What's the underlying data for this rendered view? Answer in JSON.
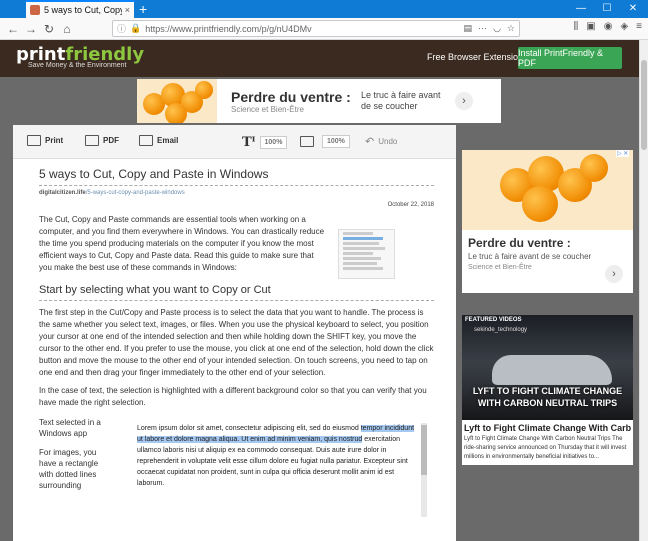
{
  "browser": {
    "tab_title": "5 ways to Cut, Copy and Paste",
    "tab_close": "×",
    "new_tab": "+",
    "url": "https://www.printfriendly.com/p/g/nU4DMv",
    "window_controls": [
      "—",
      "☐",
      "✕"
    ]
  },
  "pf_header": {
    "logo_print": "print",
    "logo_friendly": "friendly",
    "tagline": "Save Money & the Environment",
    "extension_label": "Free  Browser Extension!",
    "install_button": "Install PrintFriendly & PDF"
  },
  "top_ad": {
    "title": "Perdre du ventre :",
    "source": "Science et Bien-Être",
    "description": "Le truc à faire avant de se coucher",
    "arrow": "›"
  },
  "toolbar": {
    "print_label": "Print",
    "pdf_label": "PDF",
    "email_label": "Email",
    "text_size": "100%",
    "image_size": "100%",
    "undo_label": "Undo"
  },
  "article": {
    "title": "5 ways to Cut, Copy and Paste in Windows",
    "site_domain": "digitalcitizen.life",
    "site_path": "/5-ways-cut-copy-and-paste-windows",
    "date": "October 22, 2018",
    "intro": "The Cut, Copy and Paste commands are essential tools when working on a computer, and you find them everywhere in Windows. You can drastically reduce the time you spend producing materials on the computer if you know the most efficient ways to Cut, Copy and Paste data. Read this guide to make sure that you make the best use of these commands in Windows:",
    "heading": "Start by selecting what you want to Copy or Cut",
    "para1": "The first step in the Cut/Copy and Paste process is to select the data that you want to handle. The process is the same whether you select text, images, or files. When you use the physical keyboard to select, you position your cursor at one end of the intended selection and then while holding down the SHIFT key, you move the cursor to the other end. If you prefer to use the mouse, you click at one end of the selection, hold down the click button and move the mouse to the other end of your intended selection. On touch screens, you need to tap on one end and then drag your finger immediately to the other end of your selection.",
    "para2": "In the case of text, the selection is highlighted with a different background color so that you can verify that you have made the right selection.",
    "side1": "Text selected in a Windows app",
    "side2": "For images, you have a rectangle with dotted lines surrounding",
    "lorem_pre": "Lorem ipsum dolor sit amet, consectetur adipiscing elit, sed do eiusmod ",
    "lorem_hl": "tempor incididunt ut labore et dolore magna aliqua. Ut enim ad minim veniam, quis nostrud",
    "lorem_post": " exercitation ullamco laboris nisi ut aliquip ex ea commodo consequat. Duis aute irure dolor in reprehenderit in voluptate velit esse cillum dolore eu fugiat nulla pariatur. Excepteur sint occaecat cupidatat non proident, sunt in culpa qui officia deserunt mollit anim id est laborum."
  },
  "right_ad": {
    "adchoices": "▷ ✕",
    "title": "Perdre du ventre :",
    "description": "Le truc à faire avant de se coucher",
    "source": "Science et Bien-Être",
    "arrow": "›"
  },
  "video": {
    "featured_label": "FEATURED VIDEOS",
    "user": "sekinde_technology",
    "caption": "LYFT TO FIGHT CLIMATE CHANGE WITH CARBON NEUTRAL TRIPS",
    "below_title": "Lyft to Fight Climate Change With Carbon...",
    "below_desc": "Lyft to Fight Climate Change With Carbon Neutral Trips The ride-sharing service announced on Thursday that it will invest millions in environmentally beneficial initiatives to..."
  }
}
